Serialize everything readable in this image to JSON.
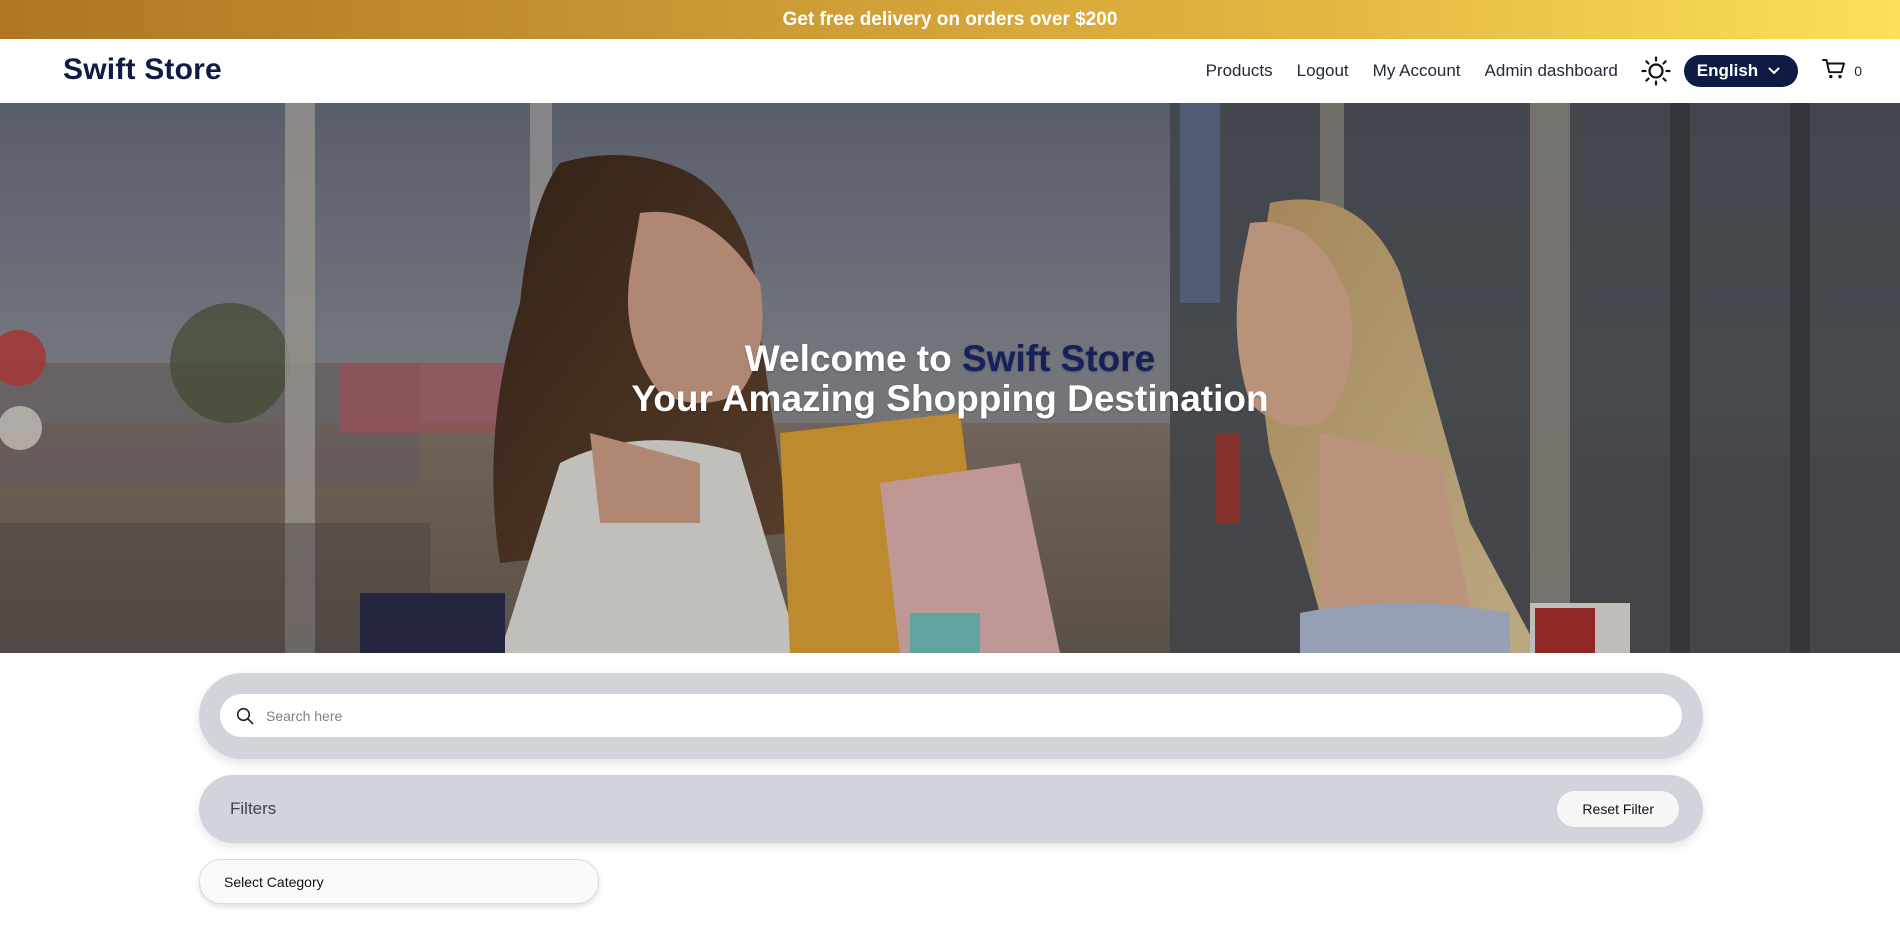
{
  "promo": {
    "text": "Get free delivery on orders over $200"
  },
  "header": {
    "logo": "Swift Store",
    "nav": [
      "Products",
      "Logout",
      "My Account",
      "Admin dashboard"
    ],
    "language": "English",
    "cart_count": "0"
  },
  "hero": {
    "welcome": "Welcome to ",
    "brand": "Swift Store",
    "subtitle": "Your Amazing Shopping Destination"
  },
  "search": {
    "placeholder": "Search here"
  },
  "filters": {
    "label": "Filters",
    "reset_label": "Reset Filter"
  },
  "category": {
    "selected": "Select Category"
  },
  "colors": {
    "brand": "#0f1a45",
    "promo_start": "#b07623",
    "promo_end": "#fde05a",
    "panel": "#d1d5db"
  }
}
